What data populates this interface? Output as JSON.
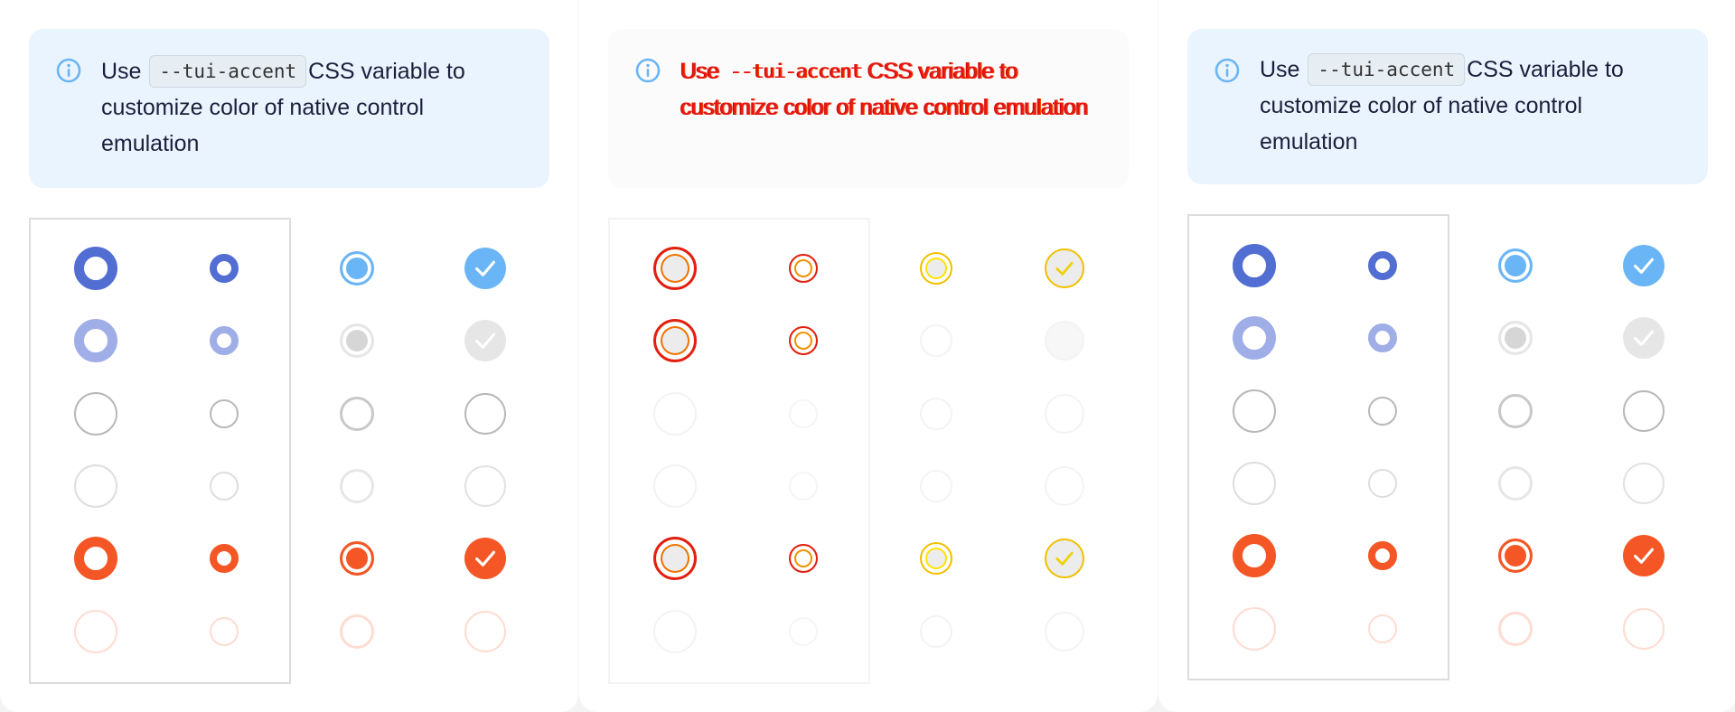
{
  "notice": {
    "prefix": "Use",
    "code": "--tui-accent",
    "suffix": "CSS variable to customize color of native control emulation"
  },
  "icons": {
    "info": "info-circle-icon",
    "check": "check-icon"
  },
  "colors": {
    "primary": "#526ed3",
    "primary_light": "#a0aee8",
    "accent_blue": "#6ab5f5",
    "error": "#f45725",
    "error_light": "#fddcd1",
    "border_normal": "#b8b8b8",
    "border_light": "#dedede",
    "disabled_fill": "#e6e6e6",
    "info_bg": "#eaf4fe"
  },
  "rows": [
    "checked",
    "checked-disabled",
    "unchecked",
    "unchecked-disabled",
    "invalid-checked",
    "invalid-disabled"
  ],
  "columns": [
    "radio-large",
    "radio-small",
    "native-radio",
    "native-checkbox"
  ]
}
